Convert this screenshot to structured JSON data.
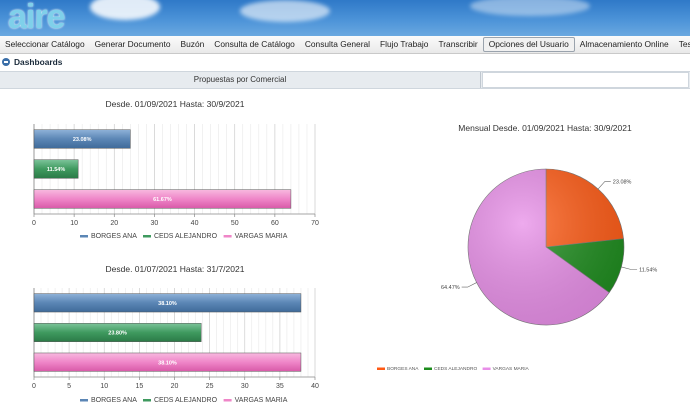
{
  "app": {
    "logo": "aire"
  },
  "menu": {
    "items": [
      {
        "id": "seleccionar",
        "label": "Seleccionar Catálogo",
        "active": false
      },
      {
        "id": "generar",
        "label": "Generar Documento",
        "active": false
      },
      {
        "id": "buzon",
        "label": "Buzón",
        "active": false
      },
      {
        "id": "consulta-catalogo",
        "label": "Consulta de Catálogo",
        "active": false
      },
      {
        "id": "consulta-general",
        "label": "Consulta General",
        "active": false
      },
      {
        "id": "flujo",
        "label": "Flujo Trabajo",
        "active": false
      },
      {
        "id": "transcribir",
        "label": "Transcribir",
        "active": false
      },
      {
        "id": "opciones",
        "label": "Opciones del Usuario",
        "active": true
      },
      {
        "id": "almacenamiento",
        "label": "Almacenamiento Online",
        "active": false
      },
      {
        "id": "tesauro",
        "label": "Tesauro",
        "active": false
      }
    ]
  },
  "breadcrumb": {
    "title": "Dashboards"
  },
  "tabs": [
    {
      "label": "Propuestas por Comercial"
    }
  ],
  "colors": {
    "borges": "#5b86b5",
    "ceds": "#3f9a5f",
    "vargas": "#ef86c8",
    "pie_borges": "#ff5a14",
    "pie_ceds": "#1d8c1d",
    "pie_vargas": "#e88ee8"
  },
  "chart_data": [
    {
      "type": "bar",
      "orientation": "horizontal",
      "title": "Desde. 01/09/2021 Hasta: 30/9/2021",
      "categories": [
        "BORGES ANA",
        "CEDS ALEJANDRO",
        "VARGAS MARIA"
      ],
      "values": [
        24,
        11,
        64
      ],
      "data_labels": [
        "23.08%",
        "11.54%",
        "61.67%"
      ],
      "xlim": [
        0,
        70
      ],
      "xticks": [
        0,
        10,
        20,
        30,
        40,
        50,
        60,
        70
      ],
      "grid": true,
      "legend": [
        "BORGES ANA",
        "CEDS ALEJANDRO",
        "VARGAS MARIA"
      ],
      "legend_position": "bottom"
    },
    {
      "type": "bar",
      "orientation": "horizontal",
      "title": "Desde. 01/07/2021 Hasta: 31/7/2021",
      "categories": [
        "BORGES ANA",
        "CEDS ALEJANDRO",
        "VARGAS MARIA"
      ],
      "values": [
        38,
        23.8,
        38
      ],
      "data_labels": [
        "38.10%",
        "23.80%",
        "38.10%"
      ],
      "xlim": [
        0,
        40
      ],
      "xticks": [
        0,
        5,
        10,
        15,
        20,
        25,
        30,
        35,
        40
      ],
      "grid": true,
      "legend": [
        "BORGES ANA",
        "CEDS ALEJANDRO",
        "VARGAS MARIA"
      ],
      "legend_position": "bottom"
    },
    {
      "type": "pie",
      "title": "Mensual Desde. 01/09/2021 Hasta: 30/9/2021",
      "categories": [
        "BORGES ANA",
        "CEDS ALEJANDRO",
        "VARGAS MARIA"
      ],
      "values": [
        23.08,
        11.54,
        64.47
      ],
      "data_labels": [
        "23.08%",
        "11.54%",
        "64.47%"
      ],
      "legend": [
        "BORGES ANA",
        "CEDS ALEJANDRO",
        "VARGAS MARIA"
      ],
      "legend_position": "bottom"
    }
  ]
}
